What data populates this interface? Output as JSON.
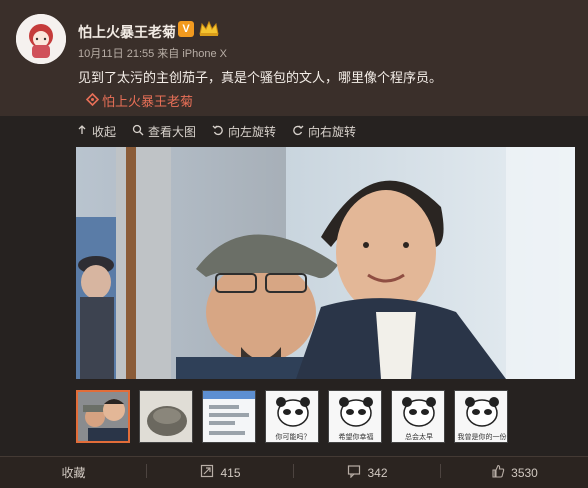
{
  "post": {
    "username": "怕上火暴王老菊",
    "verified_badge": "V",
    "meta": "10月11日 21:55 来自 iPhone X",
    "text": "见到了太污的主创茄子，真是个骚包的文人，哪里像个程序员。",
    "mention": "怕上火暴王老菊"
  },
  "toolbar": {
    "collapse": "收起",
    "view_large": "查看大图",
    "rotate_left": "向左旋转",
    "rotate_right": "向右旋转"
  },
  "thumbnails": [
    {
      "name": "selfie"
    },
    {
      "name": "pot"
    },
    {
      "name": "chat-screenshot"
    },
    {
      "name": "panda-meme-1",
      "caption": "你可能吗？"
    },
    {
      "name": "panda-meme-2",
      "caption": "希望你幸福"
    },
    {
      "name": "panda-meme-3",
      "caption": "总会太早"
    },
    {
      "name": "panda-meme-4",
      "caption": "我曾是你的一份"
    }
  ],
  "footer": {
    "favorite": "收藏",
    "repost_count": "415",
    "comment_count": "342",
    "like_count": "3530"
  },
  "colors": {
    "accent": "#e76f57",
    "badge": "#f29a1f",
    "selected_border": "#e26d39"
  }
}
